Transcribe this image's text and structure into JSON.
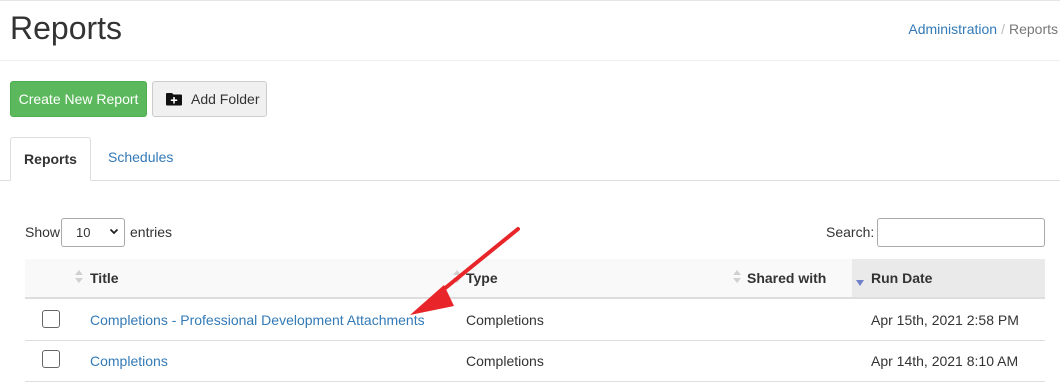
{
  "header": {
    "title": "Reports"
  },
  "breadcrumb": {
    "items": [
      "Administration",
      "Reports"
    ]
  },
  "toolbar": {
    "create_label": "Create New Report",
    "add_folder_label": "Add Folder"
  },
  "tabs": [
    {
      "label": "Reports",
      "active": true
    },
    {
      "label": "Schedules",
      "active": false
    }
  ],
  "table_controls": {
    "show_label": "Show",
    "page_size": "10",
    "entries_label": "entries",
    "search_label": "Search:",
    "search_value": ""
  },
  "table": {
    "columns": [
      "Title",
      "Type",
      "Shared with",
      "Run Date"
    ],
    "rows": [
      {
        "title": "Completions - Professional Development Attachments",
        "type": "Completions",
        "shared_with": "",
        "run_date": "Apr 15th, 2021 2:58 PM"
      },
      {
        "title": "Completions",
        "type": "Completions",
        "shared_with": "",
        "run_date": "Apr 14th, 2021 8:10 AM"
      }
    ]
  },
  "colors": {
    "primary_link": "#337ab7",
    "success": "#5cb85c",
    "annotation_arrow": "#e8262a",
    "sort_active": "#6f7fc8"
  }
}
